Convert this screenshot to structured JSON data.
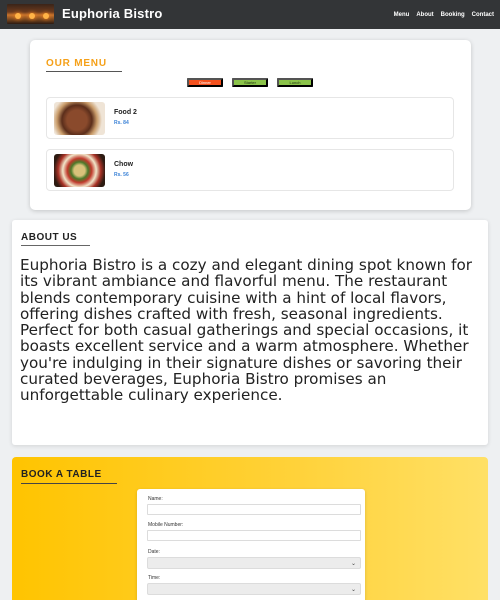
{
  "header": {
    "brand": "Euphoria Bistro",
    "nav": [
      "Menu",
      "About",
      "Booking",
      "Contact"
    ]
  },
  "menu": {
    "title": "OUR MENU",
    "tabs": [
      "Dinner",
      "Starter",
      "Lunch"
    ],
    "active_tab": "Dinner",
    "items": [
      {
        "name": "Food 2",
        "price": "Rs. 84"
      },
      {
        "name": "Chow",
        "price": "Rs. 56"
      }
    ]
  },
  "about": {
    "title": "ABOUT US",
    "text": "Euphoria Bistro is a cozy and elegant dining spot known for its vibrant ambiance and flavorful menu. The restaurant blends contemporary cuisine with a hint of local flavors, offering dishes crafted with fresh, seasonal ingredients. Perfect for both casual gatherings and special occasions, it boasts excellent service and a warm atmosphere. Whether you're indulging in their signature dishes or savoring their curated beverages, Euphoria Bistro promises an unforgettable culinary experience."
  },
  "booking": {
    "title": "BOOK A TABLE",
    "fields": {
      "name_label": "Name:",
      "mobile_label": "Mobile Number:",
      "date_label": "Date:",
      "time_label": "Time:"
    }
  },
  "colors": {
    "accent": "#f5a018",
    "active_tab": "#f4511e",
    "inactive_tab": "#8bc34a",
    "price": "#3b82d6",
    "navbar": "#333537"
  }
}
